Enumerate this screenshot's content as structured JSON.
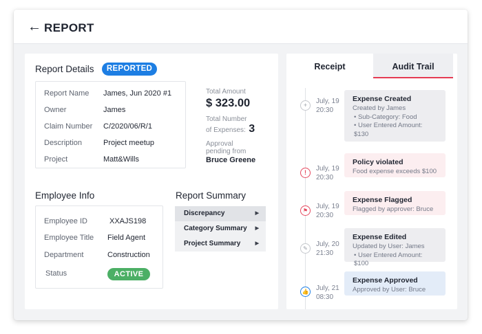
{
  "header": {
    "back_icon": "←",
    "title": "REPORT"
  },
  "report_details": {
    "title": "Report Details",
    "status": "REPORTED",
    "fields": [
      {
        "label": "Report Name",
        "value": "James, Jun 2020 #1"
      },
      {
        "label": "Owner",
        "value": "James"
      },
      {
        "label": "Claim Number",
        "value": "C/2020/06/R/1"
      },
      {
        "label": "Description",
        "value": "Project meetup"
      },
      {
        "label": "Project",
        "value": "Matt&Wills"
      }
    ],
    "total_amount_label": "Total Amount",
    "total_amount": "$ 323.00",
    "expenses_label_1": "Total Number",
    "expenses_label_2": "of Expenses:",
    "expenses_count": "3",
    "approval_label_1": "Approval",
    "approval_label_2": "pending from",
    "approver": "Bruce Greene"
  },
  "employee_info": {
    "title": "Employee Info",
    "fields": [
      {
        "label": "Employee ID",
        "value": "XXAJS198"
      },
      {
        "label": "Employee Title",
        "value": "Field Agent"
      },
      {
        "label": "Department",
        "value": "Construction"
      }
    ],
    "status_label": "Status",
    "status_value": "ACTIVE"
  },
  "report_summary": {
    "title": "Report Summary",
    "items": [
      {
        "label": "Discrepancy"
      },
      {
        "label": "Category Summary"
      },
      {
        "label": "Project Summary"
      }
    ]
  },
  "tabs": {
    "receipt": "Receipt",
    "audit_trail": "Audit Trail"
  },
  "timeline": [
    {
      "date": "July, 19",
      "time": "20:30",
      "title": "Expense Created",
      "lines": [
        "Created by James",
        "• Sub-Category: Food",
        "• User Entered Amount: $130"
      ],
      "icon": "plus-icon"
    },
    {
      "date": "July, 19",
      "time": "20:30",
      "title": "Policy violated",
      "lines": [
        "Food expense exceeds $100"
      ],
      "icon": "alert-icon"
    },
    {
      "date": "July, 19",
      "time": "20:30",
      "title": "Expense Flagged",
      "lines": [
        "Flagged by approver: Bruce"
      ],
      "icon": "flag-icon"
    },
    {
      "date": "July, 20",
      "time": "21:30",
      "title": "Expense Edited",
      "lines": [
        "Updated by User: James",
        "• User Entered Amount: $100"
      ],
      "icon": "pencil-icon"
    },
    {
      "date": "July, 21",
      "time": "08:30",
      "title": "Expense Approved",
      "lines": [
        "Approved by User: Bruce"
      ],
      "icon": "thumbs-up-icon"
    }
  ],
  "colors": {
    "accent_blue": "#1d7ee3",
    "active_green": "#4caf65",
    "tab_underline": "#e53a53"
  }
}
